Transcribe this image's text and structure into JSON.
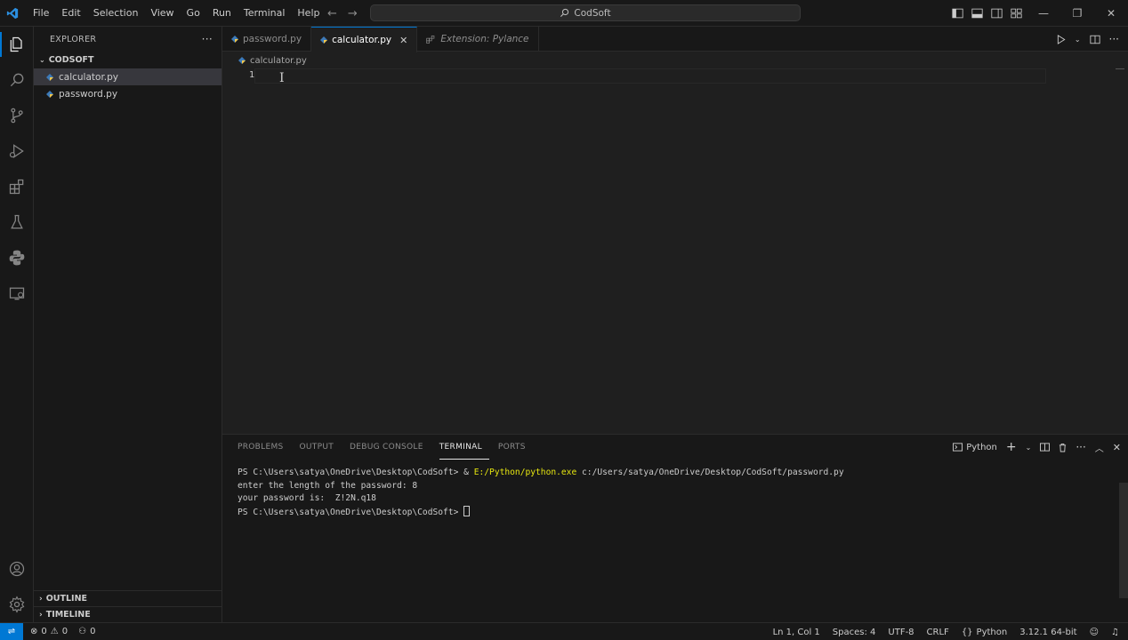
{
  "titlebar": {
    "menus": [
      "File",
      "Edit",
      "Selection",
      "View",
      "Go",
      "Run",
      "Terminal",
      "Help"
    ],
    "search_text": "CodSoft"
  },
  "sidebar": {
    "title": "EXPLORER",
    "folder": "CODSOFT",
    "files": [
      "calculator.py",
      "password.py"
    ],
    "outline": "OUTLINE",
    "timeline": "TIMELINE"
  },
  "editor": {
    "tabs": [
      {
        "label": "password.py"
      },
      {
        "label": "calculator.py"
      },
      {
        "label": "Extension: Pylance"
      }
    ],
    "breadcrumb": "calculator.py",
    "line_number": "1"
  },
  "panel": {
    "tabs": [
      "PROBLEMS",
      "OUTPUT",
      "DEBUG CONSOLE",
      "TERMINAL",
      "PORTS"
    ],
    "terminal_name": "Python",
    "lines": {
      "l1_prompt": "PS C:\\Users\\satya\\OneDrive\\Desktop\\CodSoft> ",
      "l1_amp": "& ",
      "l1_exe": "E:/Python/python.exe",
      "l1_rest": " c:/Users/satya/OneDrive/Desktop/CodSoft/password.py",
      "l2": "enter the length of the password: 8",
      "l3": "your password is:  Z!2N.q18",
      "l4_prompt": "PS C:\\Users\\satya\\OneDrive\\Desktop\\CodSoft> "
    }
  },
  "status": {
    "errors": "0",
    "warnings": "0",
    "ports": "0",
    "position": "Ln 1, Col 1",
    "spaces": "Spaces: 4",
    "encoding": "UTF-8",
    "eol": "CRLF",
    "language": "Python",
    "interpreter": "3.12.1 64-bit"
  },
  "colors": {
    "accent": "#0078d4",
    "python_blue": "#3d7ab8",
    "python_yellow": "#f5c84c"
  }
}
